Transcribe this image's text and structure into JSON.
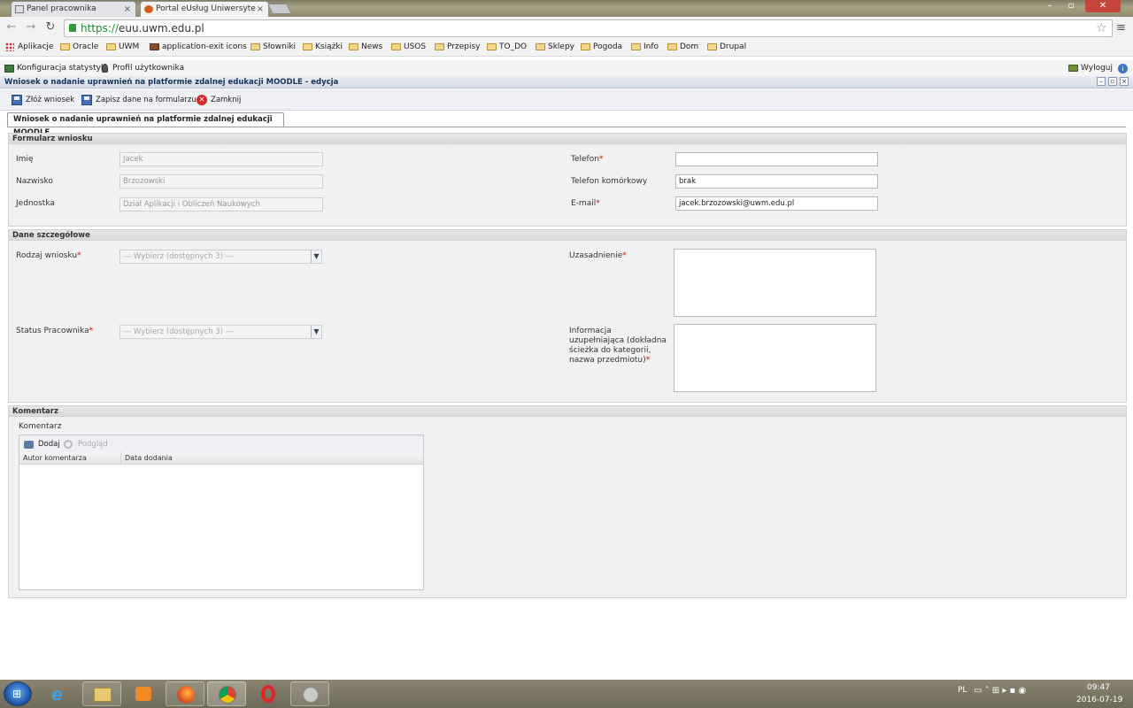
{
  "browser": {
    "tabs": [
      {
        "title": "Panel pracownika",
        "active": false
      },
      {
        "title": "Portal eUsług Uniwersyte",
        "active": true
      }
    ],
    "url": "https://euu.uwm.edu.pl",
    "bookmarks": [
      "Aplikacje",
      "Oracle",
      "UWM",
      "application-exit icons",
      "Słowniki",
      "Książki",
      "News",
      "USOS",
      "Przepisy",
      "TO_DO",
      "Sklepy",
      "Pogoda",
      "Info",
      "Dom",
      "Drupal"
    ]
  },
  "app": {
    "top_links": [
      "Konfiguracja statystyk",
      "Profil użytkownika"
    ],
    "logout": "Wyloguj",
    "window_title": "Wniosek o nadanie uprawnień na platformie zdalnej edukacji MOODLE - edycja",
    "toolbar": {
      "submit": "Złóż wniosek",
      "save": "Zapisz dane na formularzu",
      "close": "Zamknij"
    },
    "form_tab": "Wniosek o nadanie uprawnień na platformie zdalnej edukacji MOODLE",
    "section1": {
      "title": "Formularz wniosku",
      "imie_label": "Imię",
      "imie_value": "Jacek",
      "nazwisko_label": "Nazwisko",
      "nazwisko_value": "Brzozowski",
      "jednostka_label": "Jednostka",
      "jednostka_value": "Dział Aplikacji i Obliczeń Naukowych",
      "telefon_label": "Telefon",
      "telefon_value": "",
      "komorka_label": "Telefon komórkowy",
      "komorka_value": "brak",
      "email_label": "E-mail",
      "email_value": "jacek.brzozowski@uwm.edu.pl"
    },
    "section2": {
      "title": "Dane szczegółowe",
      "rodzaj_label": "Rodzaj wniosku",
      "rodzaj_value": "--- Wybierz (dostępnych 3) ---",
      "status_label": "Status Pracownika",
      "status_value": "--- Wybierz (dostępnych 3) ---",
      "uzasadnienie_label": "Uzasadnienie",
      "info_label": "Informacja uzupełniająca (dokładna ścieżka do kategorii, nazwa przedmiotu)"
    },
    "section3": {
      "title": "Komentarz",
      "subtitle": "Komentarz",
      "add": "Dodaj",
      "preview": "Podgląd",
      "columns": [
        "Autor komentarza",
        "Data dodania"
      ]
    }
  },
  "taskbar": {
    "lang": "PL",
    "time": "09:47",
    "date": "2016-07-19"
  },
  "colors": {
    "required": "#dd0000",
    "section_bg": "#f1f1f1",
    "taskbar": "#7a7563"
  }
}
